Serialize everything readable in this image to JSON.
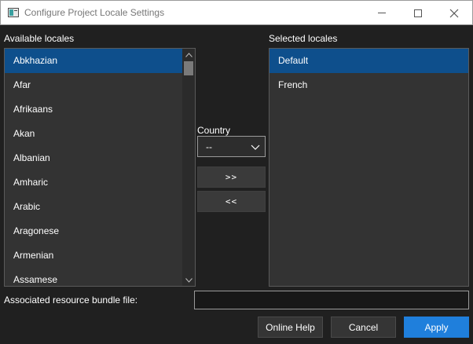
{
  "window": {
    "title": "Configure Project Locale Settings",
    "icon": "app-window-icon",
    "controls": [
      "minimize-icon",
      "maximize-icon",
      "close-icon"
    ]
  },
  "available": {
    "label": "Available locales",
    "items": [
      {
        "label": "Abkhazian",
        "selected": true
      },
      {
        "label": "Afar"
      },
      {
        "label": "Afrikaans"
      },
      {
        "label": "Akan"
      },
      {
        "label": "Albanian"
      },
      {
        "label": "Amharic"
      },
      {
        "label": "Arabic"
      },
      {
        "label": "Aragonese"
      },
      {
        "label": "Armenian"
      },
      {
        "label": "Assamese"
      }
    ]
  },
  "country": {
    "label": "Country",
    "value": "--"
  },
  "move": {
    "add_label": ">>",
    "remove_label": "<<"
  },
  "selected": {
    "label": "Selected locales",
    "items": [
      {
        "label": "Default",
        "selected": true
      },
      {
        "label": "French"
      }
    ]
  },
  "bundle": {
    "label": "Associated resource bundle file:",
    "value": ""
  },
  "buttons": {
    "help": "Online Help",
    "cancel": "Cancel",
    "apply": "Apply"
  },
  "colors": {
    "background": "#202020",
    "list_background": "#333333",
    "selection": "#0e4f8c",
    "accent": "#1f7fdc"
  }
}
